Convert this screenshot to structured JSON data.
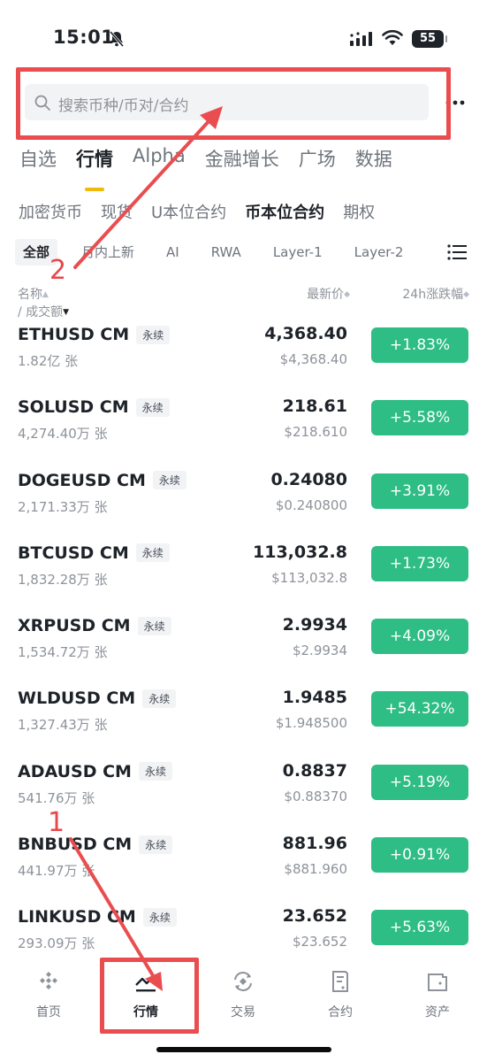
{
  "status_bar": {
    "time": "15:01",
    "battery": "55"
  },
  "search": {
    "placeholder": "搜索币种/币对/合约"
  },
  "main_tabs": [
    {
      "label": "自选"
    },
    {
      "label": "行情",
      "active": true
    },
    {
      "label": "Alpha"
    },
    {
      "label": "金融增长"
    },
    {
      "label": "广场"
    },
    {
      "label": "数据"
    }
  ],
  "sub_tabs": [
    {
      "label": "加密货币"
    },
    {
      "label": "现货"
    },
    {
      "label": "U本位合约"
    },
    {
      "label": "币本位合约",
      "active": true
    },
    {
      "label": "期权"
    }
  ],
  "filter_chips": [
    {
      "label": "全部",
      "active": true
    },
    {
      "label": "月内上新"
    },
    {
      "label": "AI"
    },
    {
      "label": "RWA"
    },
    {
      "label": "Layer-1"
    },
    {
      "label": "Layer-2"
    }
  ],
  "columns": {
    "name": "名称",
    "volume": "成交额",
    "separator": "/",
    "price": "最新价",
    "change": "24h涨跌幅"
  },
  "rows": [
    {
      "symbol": "ETHUSD CM",
      "tag": "永续",
      "volume": "1.82亿 张",
      "price": "4,368.40",
      "fiat": "$4,368.40",
      "change": "+1.83%"
    },
    {
      "symbol": "SOLUSD CM",
      "tag": "永续",
      "volume": "4,274.40万 张",
      "price": "218.61",
      "fiat": "$218.610",
      "change": "+5.58%"
    },
    {
      "symbol": "DOGEUSD CM",
      "tag": "永续",
      "volume": "2,171.33万 张",
      "price": "0.24080",
      "fiat": "$0.240800",
      "change": "+3.91%"
    },
    {
      "symbol": "BTCUSD CM",
      "tag": "永续",
      "volume": "1,832.28万 张",
      "price": "113,032.8",
      "fiat": "$113,032.8",
      "change": "+1.73%"
    },
    {
      "symbol": "XRPUSD CM",
      "tag": "永续",
      "volume": "1,534.72万 张",
      "price": "2.9934",
      "fiat": "$2.9934",
      "change": "+4.09%"
    },
    {
      "symbol": "WLDUSD CM",
      "tag": "永续",
      "volume": "1,327.43万 张",
      "price": "1.9485",
      "fiat": "$1.948500",
      "change": "+54.32%"
    },
    {
      "symbol": "ADAUSD CM",
      "tag": "永续",
      "volume": "541.76万 张",
      "price": "0.8837",
      "fiat": "$0.88370",
      "change": "+5.19%"
    },
    {
      "symbol": "BNBUSD CM",
      "tag": "永续",
      "volume": "441.97万 张",
      "price": "881.96",
      "fiat": "$881.960",
      "change": "+0.91%"
    },
    {
      "symbol": "LINKUSD CM",
      "tag": "永续",
      "volume": "293.09万 张",
      "price": "23.652",
      "fiat": "$23.652",
      "change": "+5.63%"
    }
  ],
  "bottom_nav": [
    {
      "label": "首页",
      "icon": "home-icon"
    },
    {
      "label": "行情",
      "icon": "markets-icon",
      "active": true
    },
    {
      "label": "交易",
      "icon": "trade-icon"
    },
    {
      "label": "合约",
      "icon": "futures-icon"
    },
    {
      "label": "资产",
      "icon": "wallet-icon"
    }
  ],
  "annotations": {
    "step_1": "1",
    "step_2": "2",
    "color": "#e8474a"
  },
  "colors": {
    "accent": "#f0b90b",
    "up": "#2ebd85",
    "text": "#1e2329",
    "muted": "#8e939a"
  }
}
